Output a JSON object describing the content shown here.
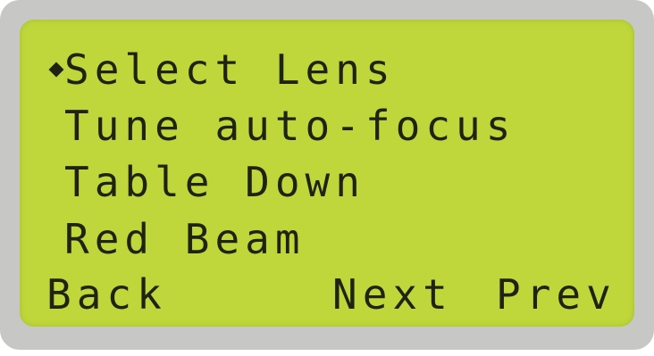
{
  "display": {
    "menu_items": [
      {
        "label": "Select Lens",
        "selected": true
      },
      {
        "label": "Tune auto-focus",
        "selected": false
      },
      {
        "label": "Table Down",
        "selected": false
      },
      {
        "label": "Red Beam",
        "selected": false
      }
    ],
    "softkeys": {
      "back": "Back",
      "next": "Next",
      "prev": "Prev"
    },
    "colors": {
      "lcd_background": "#bfd73a",
      "text": "#1f2313",
      "bezel": "#c7c7c6"
    },
    "cursor_icon": "diamond-selection-icon"
  }
}
